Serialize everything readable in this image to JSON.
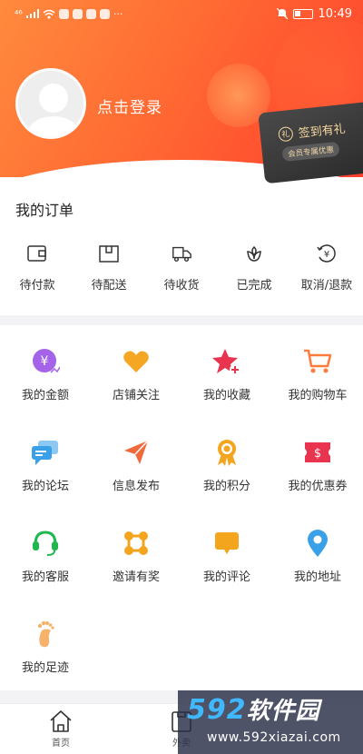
{
  "status_bar": {
    "signal": "⁴⁶",
    "time": "10:49"
  },
  "header": {
    "login_text": "点击登录",
    "signin_title": "签到有礼",
    "signin_sub": "会员专属优惠",
    "gift_glyph": "礼"
  },
  "orders": {
    "title": "我的订单",
    "items": [
      {
        "label": "待付款",
        "icon": "wallet-icon"
      },
      {
        "label": "待配送",
        "icon": "package-icon"
      },
      {
        "label": "待收货",
        "icon": "truck-icon"
      },
      {
        "label": "已完成",
        "icon": "flower-icon"
      },
      {
        "label": "取消/退款",
        "icon": "refund-icon"
      }
    ]
  },
  "services": {
    "items": [
      {
        "label": "我的金额",
        "icon": "money-icon",
        "color": "#a463e8",
        "glyph": "¥"
      },
      {
        "label": "店铺关注",
        "icon": "heart-icon",
        "color": "#f5a623"
      },
      {
        "label": "我的收藏",
        "icon": "star-icon",
        "color": "#e8344f"
      },
      {
        "label": "我的购物车",
        "icon": "cart-icon",
        "color": "#ff7a3d"
      },
      {
        "label": "我的论坛",
        "icon": "forum-icon",
        "color": "#3aa0e8"
      },
      {
        "label": "信息发布",
        "icon": "send-icon",
        "color": "#f06a3c"
      },
      {
        "label": "我的积分",
        "icon": "medal-icon",
        "color": "#f3a51e"
      },
      {
        "label": "我的优惠券",
        "icon": "coupon-icon",
        "color": "#e8344f",
        "glyph": "$"
      },
      {
        "label": "我的客服",
        "icon": "headset-icon",
        "color": "#1fb84e"
      },
      {
        "label": "邀请有奖",
        "icon": "invite-icon",
        "color": "#f3a51e"
      },
      {
        "label": "我的评论",
        "icon": "comment-icon",
        "color": "#f3a51e"
      },
      {
        "label": "我的地址",
        "icon": "location-icon",
        "color": "#3aa0e8"
      },
      {
        "label": "我的足迹",
        "icon": "footprint-icon",
        "color": "#f6b26b"
      }
    ]
  },
  "tabbar": {
    "tabs": [
      {
        "label": "首页",
        "icon": "home-icon"
      },
      {
        "label": "外卖",
        "icon": "takeout-icon"
      }
    ]
  },
  "watermark": {
    "number": "592",
    "name": "软件园",
    "url": "www.592xiazai.com"
  }
}
